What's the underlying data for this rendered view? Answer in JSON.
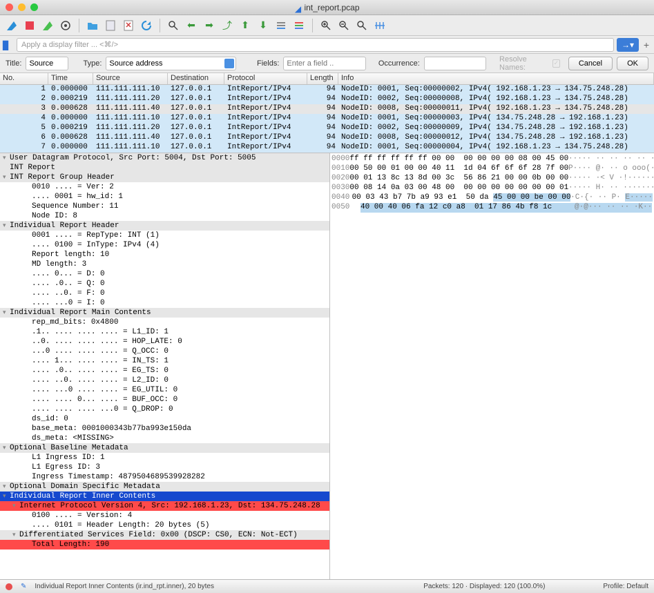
{
  "title": "int_report.pcap",
  "filter_placeholder": "Apply a display filter ... <⌘/>",
  "labels": {
    "title": "Title:",
    "title_val": "Source",
    "type": "Type:",
    "type_val": "Source address",
    "fields": "Fields:",
    "fields_ph": "Enter a field ..",
    "occurrence": "Occurrence:",
    "resolve": "Resolve Names:",
    "cancel": "Cancel",
    "ok": "OK"
  },
  "cols": {
    "no": "No.",
    "time": "Time",
    "source": "Source",
    "dest": "Destination",
    "proto": "Protocol",
    "len": "Length",
    "info": "Info"
  },
  "packets": [
    {
      "n": "1",
      "t": "0.000000",
      "s": "111.111.111.10",
      "d": "127.0.0.1",
      "p": "IntReport/IPv4",
      "l": "94",
      "i": "NodeID: 0001, Seq:00000002, IPv4(   192.168.1.23 →   134.75.248.28)",
      "c": "lite"
    },
    {
      "n": "2",
      "t": "0.000219",
      "s": "111.111.111.20",
      "d": "127.0.0.1",
      "p": "IntReport/IPv4",
      "l": "94",
      "i": "NodeID: 0002, Seq:00000008, IPv4(   192.168.1.23 →   134.75.248.28)",
      "c": "lite"
    },
    {
      "n": "3",
      "t": "0.000628",
      "s": "111.111.111.40",
      "d": "127.0.0.1",
      "p": "IntReport/IPv4",
      "l": "94",
      "i": "NodeID: 0008, Seq:00000011, IPv4(   192.168.1.23 →   134.75.248.28)",
      "c": "sel"
    },
    {
      "n": "4",
      "t": "0.000000",
      "s": "111.111.111.10",
      "d": "127.0.0.1",
      "p": "IntReport/IPv4",
      "l": "94",
      "i": "NodeID: 0001, Seq:00000003, IPv4(  134.75.248.28 →    192.168.1.23)",
      "c": "lite"
    },
    {
      "n": "5",
      "t": "0.000219",
      "s": "111.111.111.20",
      "d": "127.0.0.1",
      "p": "IntReport/IPv4",
      "l": "94",
      "i": "NodeID: 0002, Seq:00000009, IPv4(  134.75.248.28 →    192.168.1.23)",
      "c": "lite"
    },
    {
      "n": "6",
      "t": "0.000628",
      "s": "111.111.111.40",
      "d": "127.0.0.1",
      "p": "IntReport/IPv4",
      "l": "94",
      "i": "NodeID: 0008, Seq:00000012, IPv4(  134.75.248.28 →    192.168.1.23)",
      "c": "lite"
    },
    {
      "n": "7",
      "t": "0.000000",
      "s": "111.111.111.10",
      "d": "127.0.0.1",
      "p": "IntReport/IPv4",
      "l": "94",
      "i": "NodeID: 0001, Seq:00000004, IPv4(   192.168.1.23 →   134.75.248.28)",
      "c": "lite"
    }
  ],
  "tree": [
    {
      "t": "User Datagram Protocol, Src Port: 5004, Dst Port: 5005",
      "c": "hdr",
      "ch": 1
    },
    {
      "t": "INT Report",
      "c": "hdr"
    },
    {
      "t": "INT Report Group Header",
      "c": "hdr",
      "ch": 1
    },
    {
      "t": "0010 .... = Ver: 2",
      "c": "ind2"
    },
    {
      "t": ".... 0001 = hw_id: 1",
      "c": "ind2"
    },
    {
      "t": "Sequence Number: 11",
      "c": "ind2"
    },
    {
      "t": "Node ID: 8",
      "c": "ind2"
    },
    {
      "t": "Individual Report Header",
      "c": "hdr",
      "ch": 1
    },
    {
      "t": "0001 .... = RepType: INT (1)",
      "c": "ind2"
    },
    {
      "t": ".... 0100 = InType: IPv4 (4)",
      "c": "ind2"
    },
    {
      "t": "Report length: 10",
      "c": "ind2"
    },
    {
      "t": "MD length: 3",
      "c": "ind2"
    },
    {
      "t": ".... 0... = D: 0",
      "c": "ind2"
    },
    {
      "t": ".... .0.. = Q: 0",
      "c": "ind2"
    },
    {
      "t": ".... ..0. = F: 0",
      "c": "ind2"
    },
    {
      "t": ".... ...0 = I: 0",
      "c": "ind2"
    },
    {
      "t": "Individual Report Main Contents",
      "c": "hdr",
      "ch": 1
    },
    {
      "t": "rep_md_bits: 0x4800",
      "c": "ind2"
    },
    {
      "t": ".1.. .... .... .... = L1_ID: 1",
      "c": "ind2"
    },
    {
      "t": "..0. .... .... .... = HOP_LATE: 0",
      "c": "ind2"
    },
    {
      "t": "...0 .... .... .... = Q_OCC: 0",
      "c": "ind2"
    },
    {
      "t": ".... 1... .... .... = IN_TS: 1",
      "c": "ind2"
    },
    {
      "t": ".... .0.. .... .... = EG_TS: 0",
      "c": "ind2"
    },
    {
      "t": ".... ..0. .... .... = L2_ID: 0",
      "c": "ind2"
    },
    {
      "t": ".... ...0 .... .... = EG_UTIL: 0",
      "c": "ind2"
    },
    {
      "t": ".... .... 0... .... = BUF_OCC: 0",
      "c": "ind2"
    },
    {
      "t": ".... .... .... ...0 = Q_DROP: 0",
      "c": "ind2"
    },
    {
      "t": "ds_id: 0",
      "c": "ind2"
    },
    {
      "t": "base_meta: 0001000343b77ba993e150da",
      "c": "ind2"
    },
    {
      "t": "ds_meta: <MISSING>",
      "c": "ind2"
    },
    {
      "t": "Optional Baseline Metadata",
      "c": "hdr",
      "ch": 1
    },
    {
      "t": "L1 Ingress ID: 1",
      "c": "ind2"
    },
    {
      "t": "L1 Egress ID: 3",
      "c": "ind2"
    },
    {
      "t": "Ingress Timestamp: 4879504689539928282",
      "c": "ind2"
    },
    {
      "t": "Optional Domain Specific Metadata",
      "c": "hdr",
      "ch": 1
    },
    {
      "t": "Individual Report Inner Contents",
      "c": "selblue",
      "ch": 1
    },
    {
      "t": "Internet Protocol Version 4, Src: 192.168.1.23, Dst: 134.75.248.28",
      "c": "ind1 selred",
      "ch": 1
    },
    {
      "t": "0100 .... = Version: 4",
      "c": "ind2"
    },
    {
      "t": ".... 0101 = Header Length: 20 bytes (5)",
      "c": "ind2"
    },
    {
      "t": "Differentiated Services Field: 0x00 (DSCP: CS0, ECN: Not-ECT)",
      "c": "ind1 hdr",
      "ch": 1
    },
    {
      "t": "Total Length: 190",
      "c": "ind2 selred"
    }
  ],
  "hex": [
    {
      "o": "0000",
      "b": "ff ff ff ff ff ff 00 00  00 00 00 00 08 00 45 00",
      "a": "······ ·· ·· ·· ·· ··E·"
    },
    {
      "o": "0010",
      "b": "00 50 00 01 00 00 40 11  1d 04 6f 6f 6f 28 7f 00",
      "a": "·P···· @· ·· o ooo(··"
    },
    {
      "o": "0020",
      "b": "00 01 13 8c 13 8d 00 3c  56 86 21 00 00 0b 00 00",
      "a": "······ ·< V ·!······"
    },
    {
      "o": "0030",
      "b": "00 08 14 0a 03 00 48 00  00 00 00 00 00 00 00 01",
      "a": "······ H· ·· ········"
    },
    {
      "o": "0040",
      "b": "00 03 43 b7 7b a9 93 e1  50 da ",
      "a": "··C·{· ·· P· ",
      "b2": "45 00 00 be 00 00",
      "a2": "E·····",
      "hl": 1
    },
    {
      "o": "0050",
      "b": "40 00 40 06 fa 12 c0 a8  01 17 86 4b f8 1c",
      "a": "@·@··· ·· ·· ·K··",
      "hl": 2
    }
  ],
  "status": {
    "left": "Individual Report Inner Contents (ir.ind_rpt.inner), 20 bytes",
    "mid": "Packets: 120 · Displayed: 120 (100.0%)",
    "right": "Profile: Default"
  }
}
